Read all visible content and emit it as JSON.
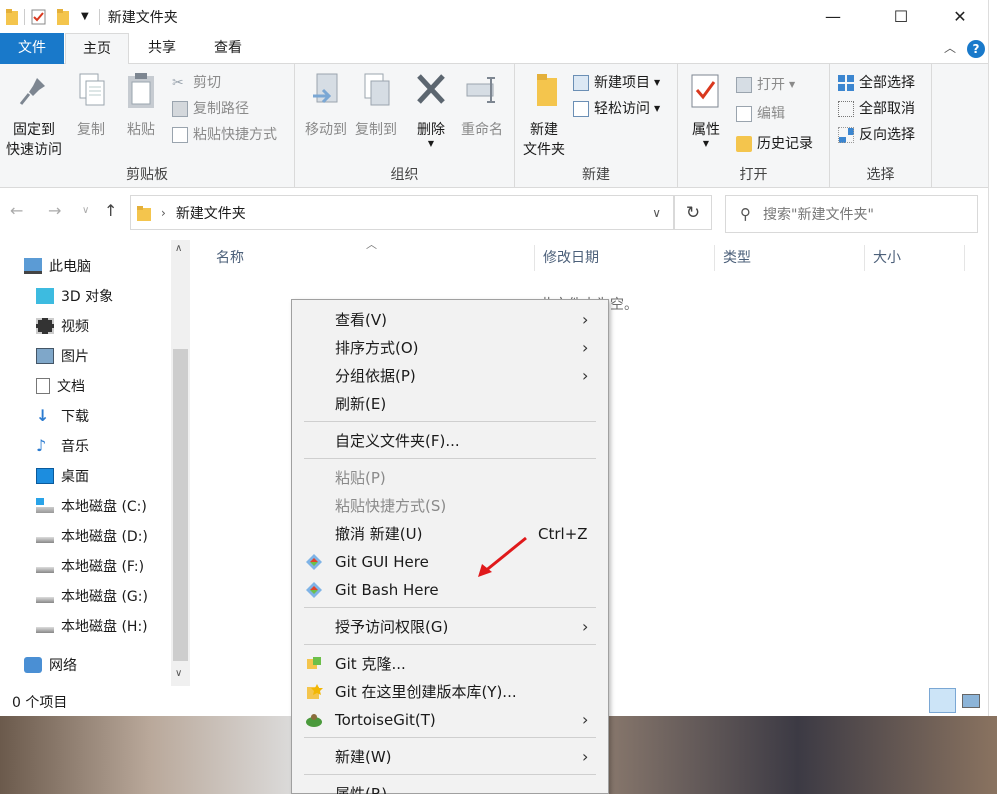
{
  "window": {
    "title": "新建文件夹",
    "minimize": "—",
    "maximize": "☐",
    "close": "✕"
  },
  "tabs": {
    "file": "文件",
    "home": "主页",
    "share": "共享",
    "view": "查看"
  },
  "ribbon": {
    "clipboard": {
      "label": "剪贴板",
      "pin": "固定到\n快速访问",
      "pin_line1": "固定到",
      "pin_line2": "快速访问",
      "copy": "复制",
      "paste": "粘贴",
      "cut": "剪切",
      "copy_path": "复制路径",
      "paste_shortcut": "粘贴快捷方式"
    },
    "organize": {
      "label": "组织",
      "move_to": "移动到",
      "copy_to": "复制到",
      "delete": "删除",
      "rename": "重命名"
    },
    "new": {
      "label": "新建",
      "new_folder_line1": "新建",
      "new_folder_line2": "文件夹",
      "new_item": "新建项目",
      "easy_access": "轻松访问"
    },
    "open": {
      "label": "打开",
      "properties": "属性",
      "open": "打开",
      "edit": "编辑",
      "history": "历史记录"
    },
    "select": {
      "label": "选择",
      "select_all": "全部选择",
      "select_none": "全部取消",
      "invert": "反向选择"
    }
  },
  "address": {
    "path": "新建文件夹",
    "search_placeholder": "搜索\"新建文件夹\""
  },
  "nav": {
    "items": [
      {
        "label": "此电脑"
      },
      {
        "label": "3D 对象"
      },
      {
        "label": "视频"
      },
      {
        "label": "图片"
      },
      {
        "label": "文档"
      },
      {
        "label": "下载"
      },
      {
        "label": "音乐"
      },
      {
        "label": "桌面"
      },
      {
        "label": "本地磁盘 (C:)"
      },
      {
        "label": "本地磁盘 (D:)"
      },
      {
        "label": "本地磁盘 (F:)"
      },
      {
        "label": "本地磁盘 (G:)"
      },
      {
        "label": "本地磁盘 (H:)"
      },
      {
        "label": "网络"
      }
    ]
  },
  "columns": {
    "name": "名称",
    "date": "修改日期",
    "type": "类型",
    "size": "大小"
  },
  "content": {
    "empty": "此文件夹为空。"
  },
  "status": {
    "count": "0 个项目"
  },
  "context_menu": {
    "items": [
      {
        "label": "查看(V)",
        "submenu": true
      },
      {
        "label": "排序方式(O)",
        "submenu": true
      },
      {
        "label": "分组依据(P)",
        "submenu": true
      },
      {
        "label": "刷新(E)"
      },
      {
        "label": "自定义文件夹(F)..."
      },
      {
        "label": "粘贴(P)",
        "disabled": true
      },
      {
        "label": "粘贴快捷方式(S)",
        "disabled": true
      },
      {
        "label": "撤消 新建(U)",
        "shortcut": "Ctrl+Z"
      },
      {
        "label": "Git GUI Here"
      },
      {
        "label": "Git Bash Here"
      },
      {
        "label": "授予访问权限(G)",
        "submenu": true
      },
      {
        "label": "Git 克隆..."
      },
      {
        "label": "Git 在这里创建版本库(Y)..."
      },
      {
        "label": "TortoiseGit(T)",
        "submenu": true
      },
      {
        "label": "新建(W)",
        "submenu": true
      },
      {
        "label": "属性(R)"
      }
    ]
  },
  "colors": {
    "accent": "#1979ca",
    "annotation_arrow": "#e0191b"
  }
}
